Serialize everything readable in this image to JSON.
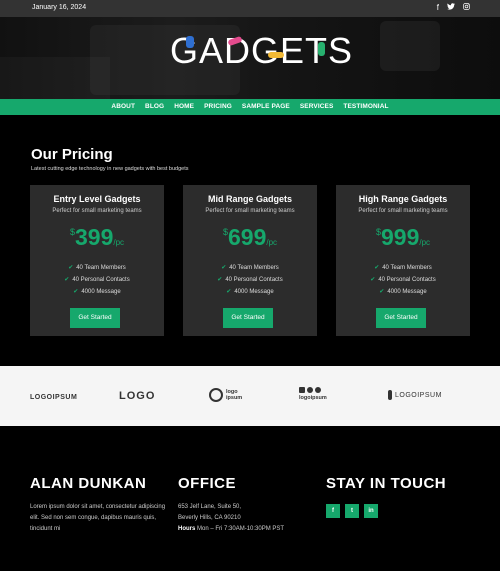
{
  "topbar": {
    "date": "January 16, 2024",
    "social": [
      {
        "icon": "facebook-icon",
        "glyph": "f"
      },
      {
        "icon": "twitter-icon",
        "glyph": "🐦"
      },
      {
        "icon": "instagram-icon",
        "glyph": "◎"
      }
    ]
  },
  "brand": {
    "logo_text": "GADGETS"
  },
  "nav": {
    "items": [
      "ABOUT",
      "BLOG",
      "HOME",
      "PRICING",
      "SAMPLE PAGE",
      "SERVICES",
      "TESTIMONIAL"
    ]
  },
  "pricing": {
    "title": "Our Pricing",
    "subtitle": "Latest cutting edge technology in new gadgets with best budgets",
    "cards": [
      {
        "title": "Entry Level Gadgets",
        "tagline": "Perfect for small marketing teams",
        "currency": "$",
        "amount": "399",
        "per": "/pc",
        "features": [
          "40 Team Members",
          "40 Personal Contacts",
          "4000 Message"
        ],
        "button": "Get Started"
      },
      {
        "title": "Mid Range Gadgets",
        "tagline": "Perfect for small marketing teams",
        "currency": "$",
        "amount": "699",
        "per": "/pc",
        "features": [
          "40 Team Members",
          "40 Personal Contacts",
          "4000 Message"
        ],
        "button": "Get Started"
      },
      {
        "title": "High Range Gadgets",
        "tagline": "Perfect for small marketing teams",
        "currency": "$",
        "amount": "999",
        "per": "/pc",
        "features": [
          "40 Team Members",
          "40 Personal Contacts",
          "4000 Message"
        ],
        "button": "Get Started"
      }
    ]
  },
  "partners": {
    "logo1": "LOGOIPSUM",
    "logo2": "LOGO",
    "logo3_line1": "logo",
    "logo3_line2": "ipsum",
    "logo4": "logoipsum",
    "logo5": "LOGOIPSUM"
  },
  "footer": {
    "col1": {
      "heading": "ALAN DUNKAN",
      "text": "Lorem ipsum dolor sit amet, consectetur adipiscing elit. Sed non sem congue, dapibus mauris quis, tincidunt mi"
    },
    "col2": {
      "heading": "OFFICE",
      "address1": "653 Jelf Lane, Suite 50,",
      "address2": "Beverly Hills, CA 90210",
      "hours_label": "Hours",
      "hours": "Mon – Fri 7:30AM-10:30PM PST"
    },
    "col3": {
      "heading": "STAY IN TOUCH",
      "social": [
        {
          "icon": "facebook-icon",
          "glyph": "f"
        },
        {
          "icon": "twitter-icon",
          "glyph": "t"
        },
        {
          "icon": "linkedin-icon",
          "glyph": "in"
        }
      ]
    }
  },
  "colors": {
    "accent": "#16a86c",
    "card_bg": "#2c2c2c",
    "topbar_bg": "#333333"
  }
}
